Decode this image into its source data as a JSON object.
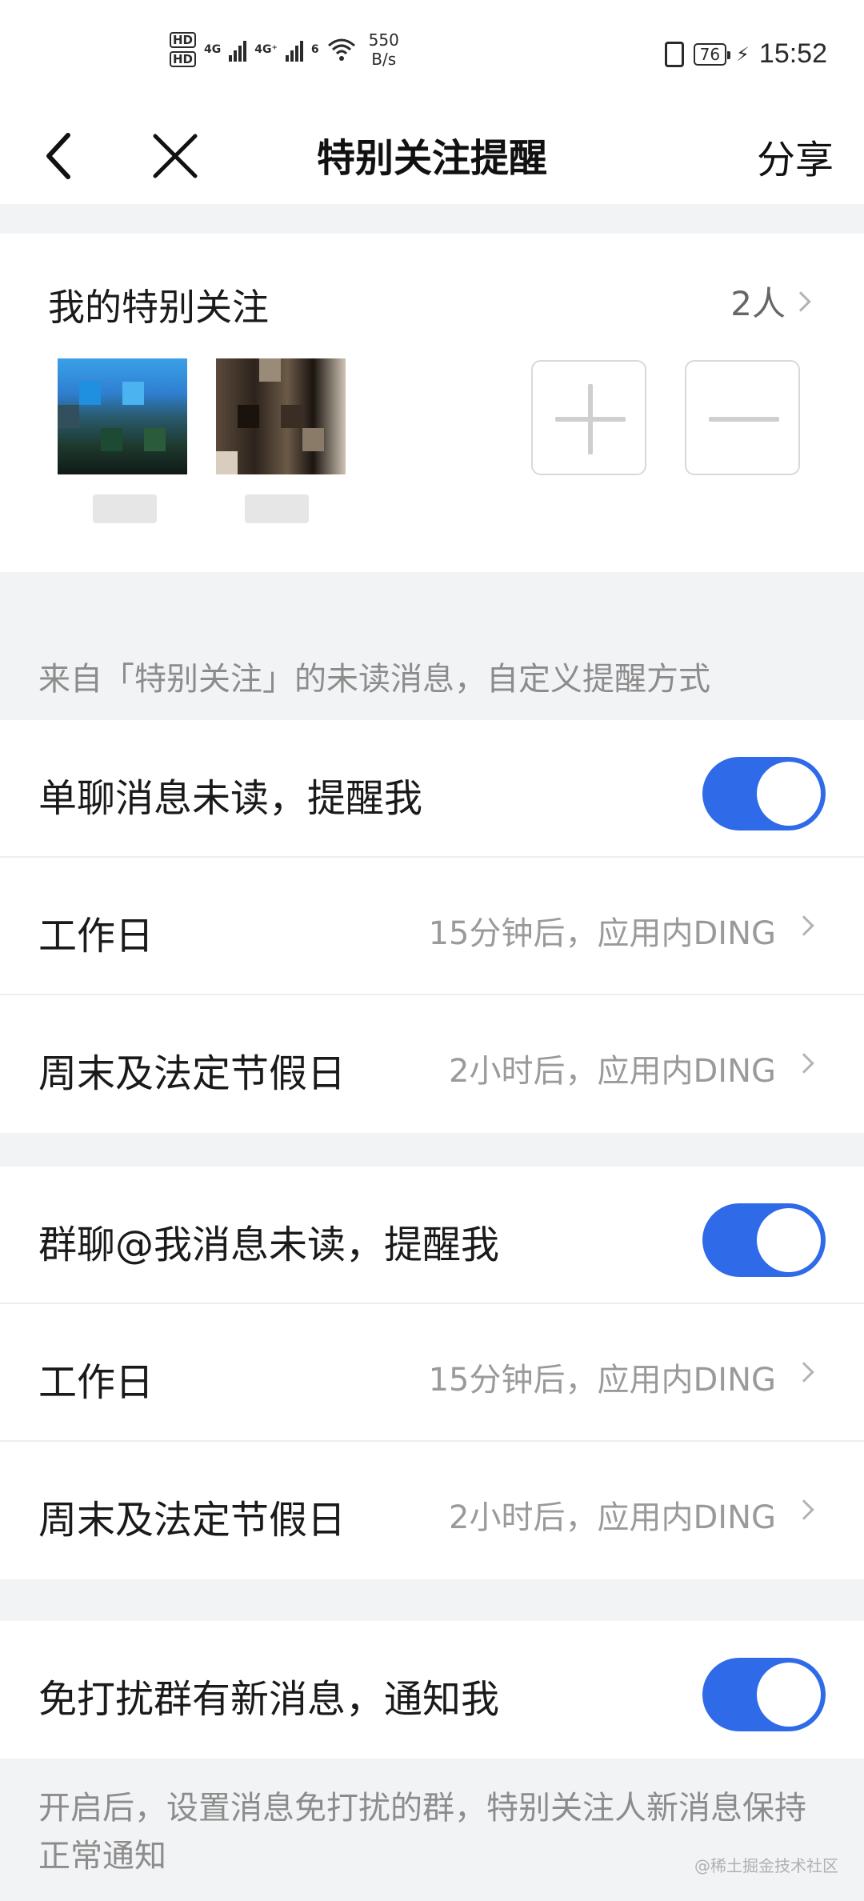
{
  "status_bar": {
    "hd1": "HD",
    "hd2": "HD",
    "sig1": "4G",
    "sig2": "4G⁺",
    "wifi_badge": "6",
    "speed_value": "550",
    "speed_unit": "B/s",
    "battery": "76",
    "time": "15:52"
  },
  "nav": {
    "title": "特别关注提醒",
    "share": "分享"
  },
  "special_follow": {
    "title": "我的特别关注",
    "count": "2人"
  },
  "section_note": "来自「特别关注」的未读消息，自定义提醒方式",
  "single_chat": {
    "toggle_label": "单聊消息未读，提醒我",
    "toggle_on": true,
    "workday_label": "工作日",
    "workday_value": "15分钟后，应用内DING",
    "holiday_label": "周末及法定节假日",
    "holiday_value": "2小时后，应用内DING"
  },
  "group_chat": {
    "toggle_label": "群聊@我消息未读，提醒我",
    "toggle_on": true,
    "workday_label": "工作日",
    "workday_value": "15分钟后，应用内DING",
    "holiday_label": "周末及法定节假日",
    "holiday_value": "2小时后，应用内DING"
  },
  "dnd": {
    "toggle_label": "免打扰群有新消息，通知我",
    "toggle_on": true
  },
  "footer_note": "开启后，设置消息免打扰的群，特别关注人新消息保持正常通知",
  "watermark": "@稀土掘金技术社区",
  "colors": {
    "accent": "#2f6be8",
    "background": "#f2f3f5"
  }
}
